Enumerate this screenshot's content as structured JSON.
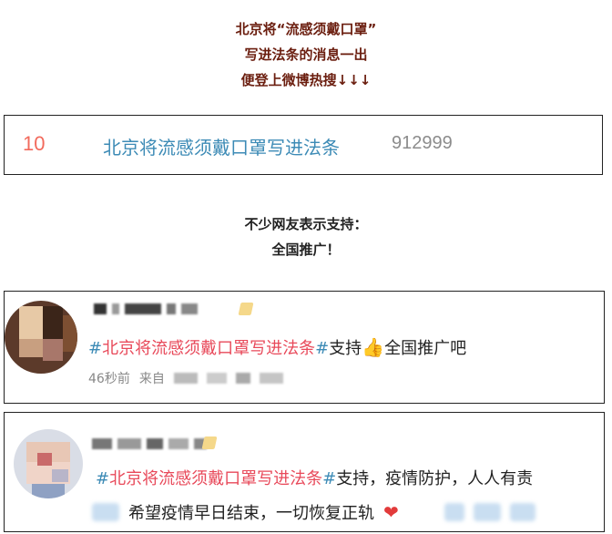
{
  "intro": {
    "lines": [
      "北京将“流感须戴口罩”",
      "写进法条的消息一出",
      "便登上微博热搜↓↓↓"
    ]
  },
  "hot_search": {
    "rank": "10",
    "title": "北京将流感须戴口罩写进法条",
    "count": "912999"
  },
  "comment_intro": {
    "lines": [
      "不少网友表示支持：",
      "全国推广！"
    ]
  },
  "posts": [
    {
      "hash_open": "#",
      "topic": "北京将流感须戴口罩写进法条",
      "hash_close": "#",
      "text_before_icon": "支持",
      "icon": "thumbs-up-icon",
      "text_after_icon": "全国推广吧",
      "time": "46秒前",
      "source_prefix": "来自"
    },
    {
      "hash_open": "#",
      "topic": "北京将流感须戴口罩写进法条",
      "hash_close": "#",
      "text_line1": "支持，疫情防护，人人有责",
      "text_line2": "希望疫情早日结束，一切恢复正轨",
      "icon": "heart-icon"
    }
  ],
  "colors": {
    "intro_title": "#6b1e0f",
    "rank": "#f26a5c",
    "hot_title": "#3d8bb6",
    "count": "#8c8c8c",
    "topic": "#e8495a",
    "hash": "#3d8bb6"
  }
}
